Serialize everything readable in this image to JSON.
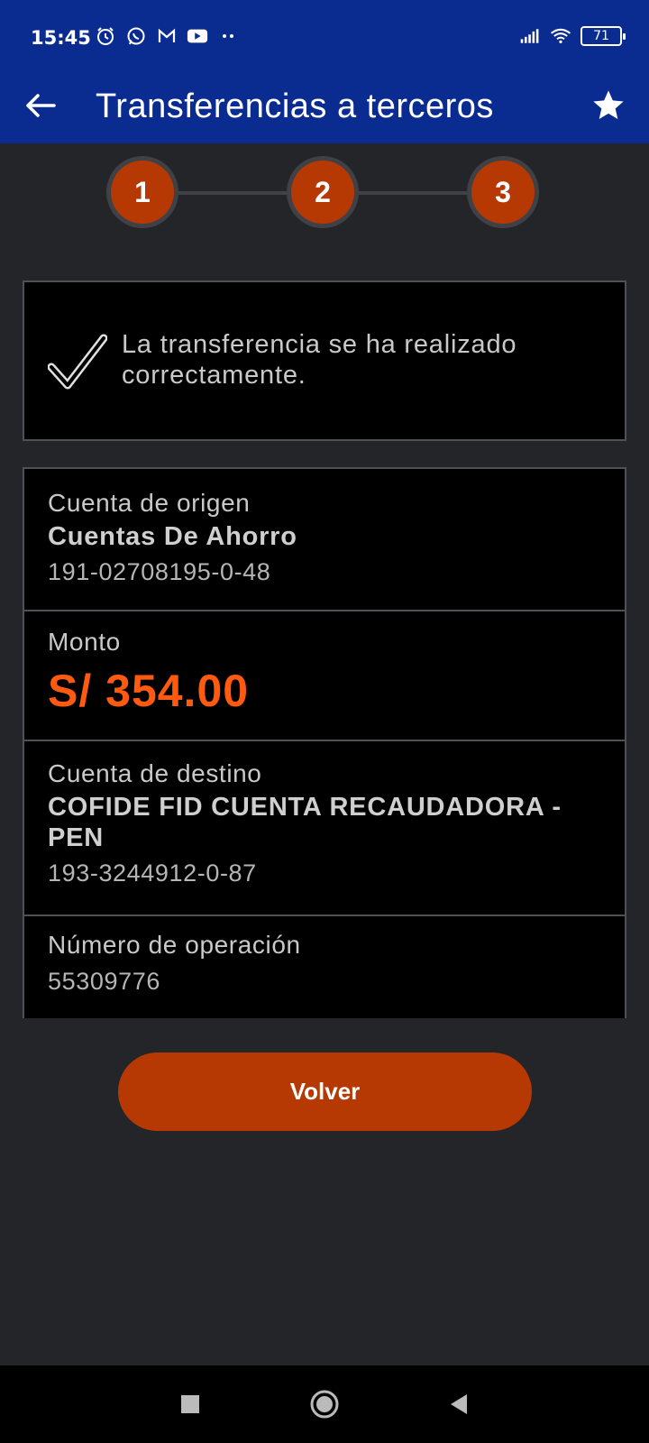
{
  "status_bar": {
    "time": "15:45",
    "battery": "71",
    "left_icons": [
      "alarm-icon",
      "whatsapp-icon",
      "gmail-icon",
      "youtube-icon",
      "more-dots-icon"
    ],
    "right_icons": [
      "signal-icon",
      "wifi-icon",
      "battery-icon"
    ]
  },
  "app_bar": {
    "title": "Transferencias a terceros",
    "back_icon": "arrow-left-icon",
    "favorite_icon": "star-icon"
  },
  "stepper": {
    "steps": [
      {
        "label": "1"
      },
      {
        "label": "2"
      },
      {
        "label": "3"
      }
    ]
  },
  "success": {
    "message": "La transferencia se ha realizado correctamente.",
    "icon": "check-icon"
  },
  "details": {
    "origin": {
      "label": "Cuenta de origen",
      "account_type": "Cuentas De Ahorro",
      "account_number": "191-02708195-0-48"
    },
    "amount": {
      "label": "Monto",
      "value": "S/ 354.00"
    },
    "destination": {
      "label": "Cuenta de destino",
      "account_name": "COFIDE FID CUENTA RECAUDADORA - PEN",
      "account_number": "193-3244912-0-87"
    },
    "operation": {
      "label": "Número de operación",
      "value": "55309776"
    }
  },
  "actions": {
    "back_label": "Volver"
  },
  "colors": {
    "primary_blue": "#0a2c91",
    "accent_orange": "#b63904",
    "amount_orange": "#ff5a10",
    "background": "#242529"
  }
}
